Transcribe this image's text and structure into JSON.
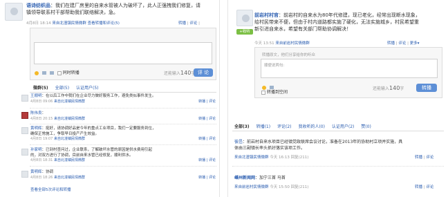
{
  "left": {
    "post": {
      "author": "语诗纺织品",
      "text_line1": "：我们在建厂房里的自来水管被人为破坏了，此人正强拽我们修复，请",
      "text_line2": "镇领导联系村干部帮助我们联络解决，急。",
      "time": "4月8日 18:14",
      "source": "来自北潼镇民情微群",
      "actions": {
        "forward": "查看转播和评论(5)",
        "fold": "转播",
        "comment": "评论"
      }
    },
    "comment_box": {
      "placeholder": "",
      "sync_label": "同时转播",
      "hint": "还能输入",
      "count": "140",
      "count_unit": "字",
      "submit": "评 论"
    },
    "tabs": {
      "active": "微群(5)",
      "all": "全部(5)",
      "verified": "认证用户(5)"
    },
    "comments": [
      {
        "user": "王顺明",
        "text": "：在以后工作中我们在企业尽力做好服务工作，避免类似事件发生。",
        "time": "4月8日 09:06",
        "source": "来自北潼镇民情微群",
        "action1": "转播",
        "action2": "评论"
      },
      {
        "user": "陈伟良",
        "text": "：",
        "time": "4月8日 20:15",
        "source": "来自北潼镇民情微群",
        "action1": "转播",
        "action2": "评论"
      },
      {
        "user": "黄明辉",
        "text": "：挺好，请协调好品是今年的重点工业项目，我们一定要服务到位，",
        "text2": "确保正常施工，争取早日投产产生效益。",
        "time": "4月8日 19:07",
        "source": "来自北潼镇民情微群",
        "action1": "转播",
        "action2": "评论"
      },
      {
        "user": "孙家明",
        "text": "：已到村查问过，企业联系，了解破坏水管的原因是供水费用引起",
        "text2": "的，对双方进行了协调，目前自来水管已经修复，顺利供水。",
        "time": "4月8日 18:31",
        "source": "来自北潼镇民情微群",
        "action1": "转播",
        "action2": "评论"
      },
      {
        "user": "黄明辉",
        "text": "：协调",
        "time": "4月8日 18:26",
        "source": "来自北潼镇民情微群",
        "action1": "转播",
        "action2": "评论"
      }
    ],
    "view_all": "查看全部5次评论和转播"
  },
  "right": {
    "post": {
      "author": "前岩村村官",
      "text_line1": "：前岩村的自来水为80年代修建，现已老化，经常出现断水现象，",
      "text_line2": "给村民带来不便，但由于村内道路都实施了硬化，无法实施城乡，村民希望重",
      "text_line3": "新引进自来水，希望有关部门帮助协调解决！",
      "time": "今天 13:51",
      "source": "来自前岩村民情微群",
      "actions": {
        "fold": "转播",
        "comment": "评论",
        "more": "更多"
      }
    },
    "badge": "+收听",
    "comment_box": {
      "forward_text": "转播原文，他们分享给你的听众",
      "placeholder": "顺便说两句:",
      "sync_label": "转播到空间",
      "hint": "还能输入",
      "count": "140",
      "count_unit": "字",
      "submit": "转播"
    },
    "tabs": {
      "all": "全部(3)",
      "forward": "转播(1)",
      "comment": "评论(2)",
      "heard": "我收听的人(0)",
      "verified": "认证用户(2)",
      "praise": "赞(0)"
    },
    "comments": [
      {
        "user": "彼邑",
        "text": "：前岩村自来水项目已经镇党政联席会议讨论，准备在2013年的协助村立项并实施，具",
        "text2": "体由三副镇长率头抓好落实该项工作。",
        "time": "今天 16:13",
        "source": "来自北潼镇民情微群",
        "reply": "回复(211)",
        "action1": "转播",
        "action2": "评论"
      },
      {
        "user": "嵊州新闻网",
        "text": "：加宁三首 马首",
        "time": "今天 15:50",
        "source": "来自前岩村民情微群",
        "reply": "回复(211)",
        "action1": "转播",
        "action2": "评论"
      }
    ]
  }
}
